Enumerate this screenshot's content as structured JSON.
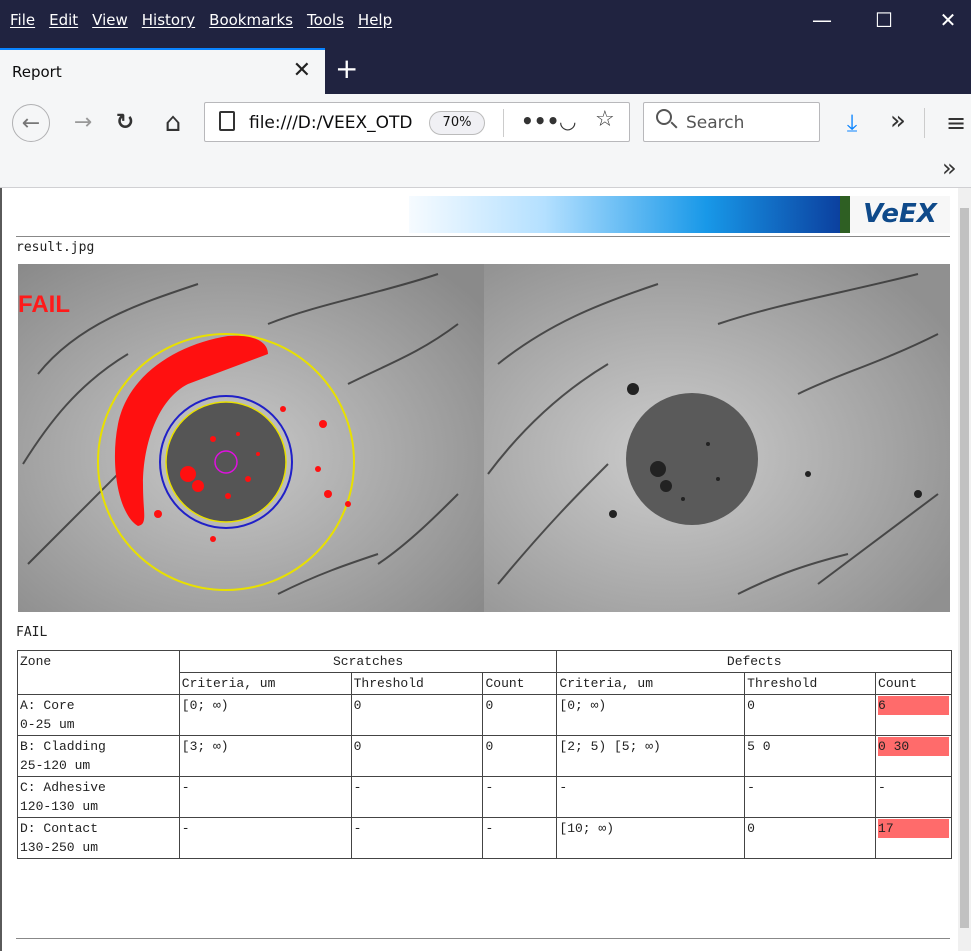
{
  "menu": [
    "File",
    "Edit",
    "View",
    "History",
    "Bookmarks",
    "Tools",
    "Help"
  ],
  "window_controls": {
    "minimize": "—",
    "maximize": "☐",
    "close": "✕"
  },
  "tab": {
    "title": "Report",
    "close": "✕",
    "new_tab": "+"
  },
  "nav": {
    "back": "←",
    "forward": "→",
    "reload": "↻",
    "home": "⌂"
  },
  "url": {
    "text": "file:///D:/VEEX_OTD",
    "zoom": "70%",
    "more": "•••",
    "pocket": "◡",
    "star": "☆"
  },
  "search": {
    "placeholder": "Search"
  },
  "toolbar": {
    "download": "⤓",
    "overflow": "»",
    "menu": "≡",
    "bookmarks_overflow": "»"
  },
  "banner": {
    "logo": "VeEX"
  },
  "report": {
    "filename": "result.jpg",
    "fail_overlay": "FAIL",
    "result": "FAIL",
    "headers": {
      "zone": "Zone",
      "scratches": "Scratches",
      "defects": "Defects",
      "criteria": "Criteria, um",
      "threshold": "Threshold",
      "count": "Count"
    },
    "rows": [
      {
        "zone": "A: Core",
        "range": "0-25 um",
        "s_crit": "[0; ∞)",
        "s_thr": "0",
        "s_cnt": "0",
        "d_crit": "[0; ∞)",
        "d_thr": "0",
        "d_cnt": "6"
      },
      {
        "zone": "B: Cladding",
        "range": "25-120 um",
        "s_crit": "[3; ∞)",
        "s_thr": "0",
        "s_cnt": "0",
        "d_crit": "[2; 5) [5; ∞)",
        "d_thr": "5 0",
        "d_cnt": "0 30"
      },
      {
        "zone": "C: Adhesive",
        "range": "120-130 um",
        "s_crit": "-",
        "s_thr": "-",
        "s_cnt": "-",
        "d_crit": "-",
        "d_thr": "-",
        "d_cnt": "-"
      },
      {
        "zone": "D: Contact",
        "range": "130-250 um",
        "s_crit": "-",
        "s_thr": "-",
        "s_cnt": "-",
        "d_crit": "[10; ∞)",
        "d_thr": "0",
        "d_cnt": "17"
      }
    ]
  }
}
